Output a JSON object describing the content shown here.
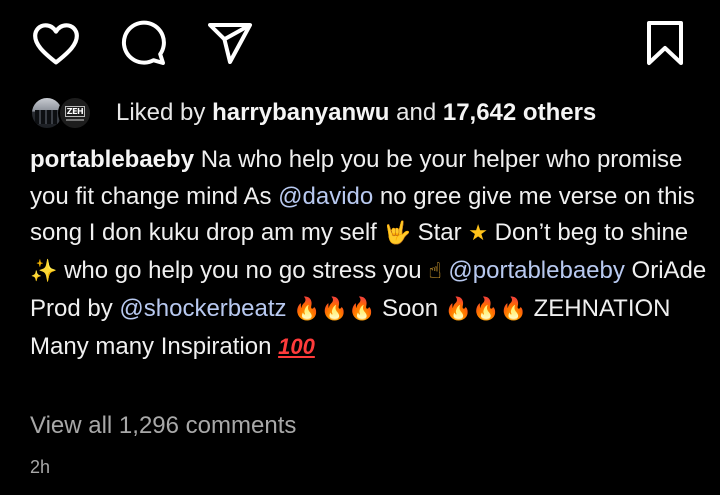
{
  "actions": {
    "like_icon": "heart-outline",
    "comment_icon": "speech-bubble-outline",
    "share_icon": "paper-plane-outline",
    "save_icon": "bookmark-outline"
  },
  "likes": {
    "prefix": "Liked by",
    "liker": "harrybanyanwu",
    "conjunction": "and",
    "others": "17,642 others",
    "avatar2_logo": "ZEH"
  },
  "caption": {
    "username": "portablebaeby",
    "text1": " Na who help you be your helper who promise you fit change mind As ",
    "mention1": "@davido",
    "text2": " no gree give me verse on this song I don kuku drop am my self ",
    "emoji_love_you": "🤟",
    "text3": " Star ",
    "emoji_star": "★",
    "text4": " Don’t beg to shine ",
    "emoji_sparkles": "✨",
    "text5": " who go help you no go stress you ",
    "emoji_point_up": "☝",
    "text6": " ",
    "mention2": "@portablebaeby",
    "text7": " OriAde Prod by ",
    "mention3": "@shockerbeatz",
    "text8": " ",
    "emoji_fire_a": "🔥🔥🔥",
    "text9": " Soon ",
    "emoji_fire_b": "🔥🔥🔥",
    "text10": " ZEHNATION Many many Inspiration ",
    "emoji_hundred": "100"
  },
  "view_comments": "View all 1,296 comments",
  "timestamp": "2h"
}
